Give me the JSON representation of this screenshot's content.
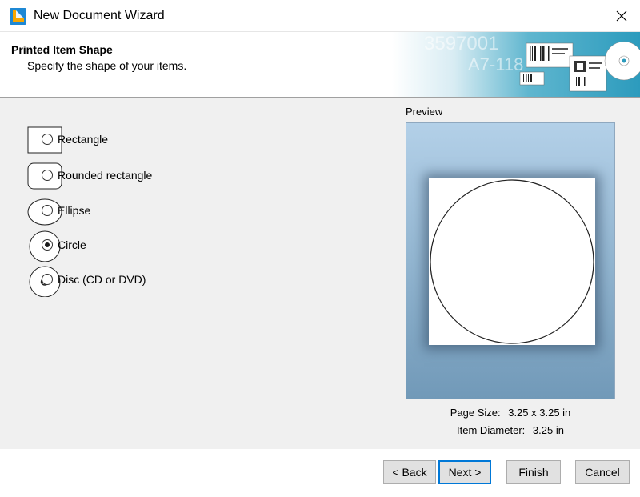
{
  "window": {
    "title": "New Document Wizard",
    "icon": "app-logo-icon",
    "close_icon": "close-icon"
  },
  "header": {
    "title": "Printed Item Shape",
    "subtitle": "Specify the shape of your items.",
    "banner_text_1": "3597001",
    "banner_text_2": "A7-118"
  },
  "shapes": [
    {
      "label": "Rectangle",
      "icon": "rectangle-shape-icon",
      "selected": false
    },
    {
      "label": "Rounded rectangle",
      "icon": "rounded-rectangle-shape-icon",
      "selected": false
    },
    {
      "label": "Ellipse",
      "icon": "ellipse-shape-icon",
      "selected": false
    },
    {
      "label": "Circle",
      "icon": "circle-shape-icon",
      "selected": true
    },
    {
      "label": "Disc (CD or DVD)",
      "icon": "disc-shape-icon",
      "selected": false
    }
  ],
  "preview": {
    "label": "Preview",
    "page_size_label": "Page Size:",
    "page_size_value": "3.25 x 3.25 in",
    "item_diameter_label": "Item Diameter:",
    "item_diameter_value": "3.25 in"
  },
  "buttons": {
    "back": "< Back",
    "next": "Next >",
    "finish": "Finish",
    "cancel": "Cancel"
  },
  "colors": {
    "accent": "#0078d7",
    "preview_top": "#b3d0e8",
    "preview_bottom": "#7199b8"
  }
}
